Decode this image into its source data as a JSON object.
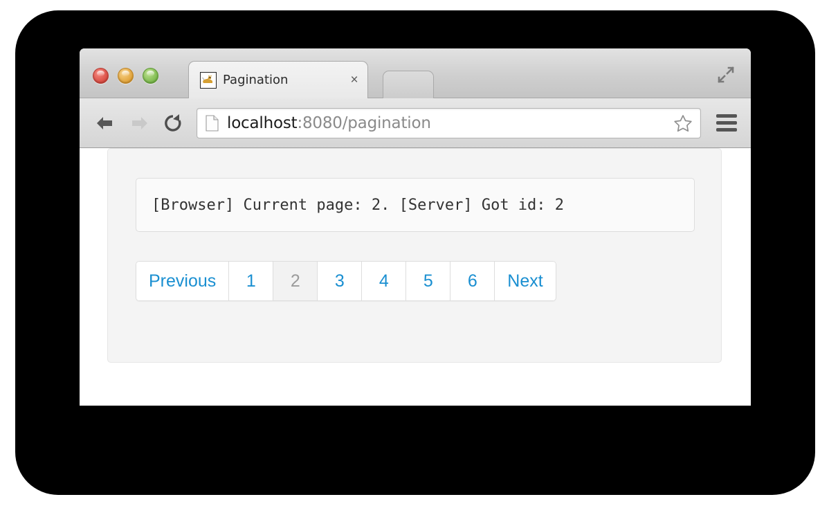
{
  "window": {
    "traffic_lights": [
      {
        "name": "close",
        "color": "#d8483f"
      },
      {
        "name": "minimize",
        "color": "#e0a033"
      },
      {
        "name": "zoom",
        "color": "#78b849"
      }
    ],
    "fullscreen_icon": "fullscreen-expand-icon"
  },
  "tab": {
    "title": "Pagination",
    "favicon": "tomcat-favicon",
    "close_label": "×",
    "new_tab_label": ""
  },
  "toolbar": {
    "back_icon": "back-arrow-icon",
    "forward_icon": "forward-arrow-icon",
    "reload_icon": "reload-icon",
    "page_icon": "document-icon",
    "star_icon": "bookmark-star-icon",
    "menu_icon": "hamburger-menu-icon",
    "url": {
      "host": "localhost",
      "rest": ":8080/pagination",
      "full": "localhost:8080/pagination"
    }
  },
  "page": {
    "message": "[Browser] Current page: 2. [Server] Got id: 2",
    "pagination": {
      "items": [
        {
          "label": "Previous",
          "active": false
        },
        {
          "label": "1",
          "active": false
        },
        {
          "label": "2",
          "active": true
        },
        {
          "label": "3",
          "active": false
        },
        {
          "label": "4",
          "active": false
        },
        {
          "label": "5",
          "active": false
        },
        {
          "label": "6",
          "active": false
        },
        {
          "label": "Next",
          "active": false
        }
      ],
      "link_color": "#1a8fd1",
      "active_color": "#9b9b9b",
      "active_bg": "#f2f2f2"
    }
  }
}
